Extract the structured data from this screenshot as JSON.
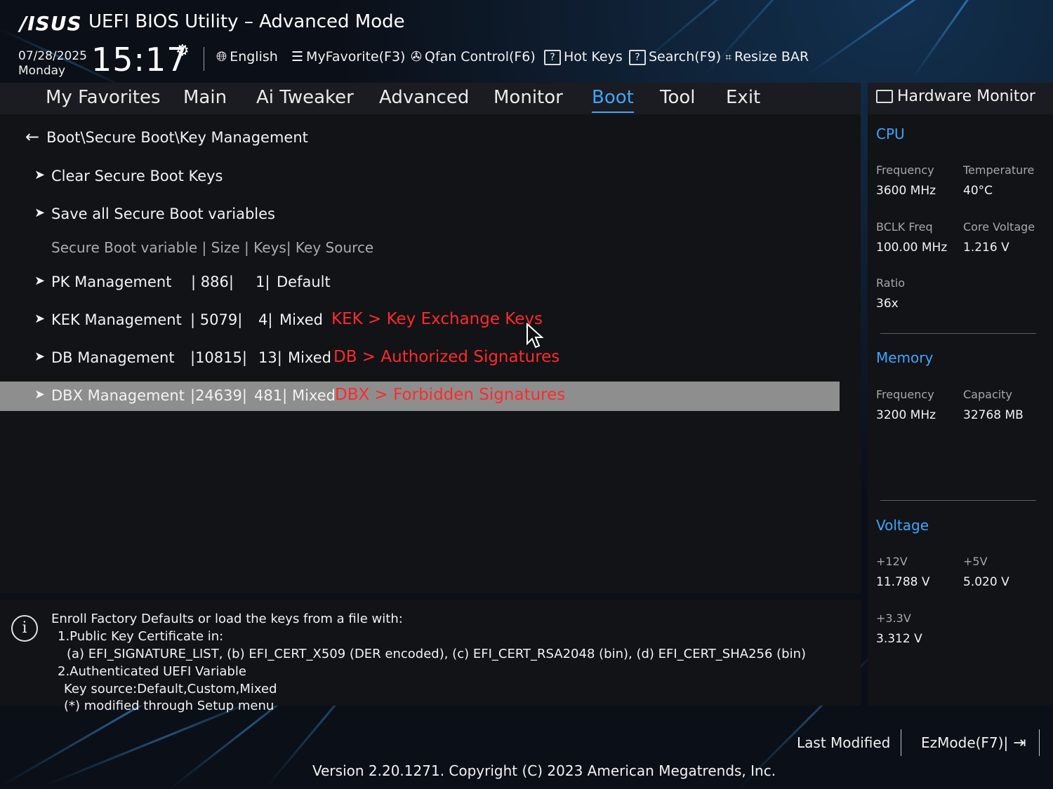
{
  "header": {
    "logo": "/ISUS",
    "title": "UEFI BIOS Utility – Advanced Mode",
    "date": "07/28/2025",
    "day": "Monday",
    "time": "15:17",
    "tools": {
      "language": "English",
      "myfavorite": "MyFavorite(F3)",
      "qfan": "Qfan Control(F6)",
      "hotkeys": "Hot Keys",
      "search": "Search(F9)",
      "resizebar": "Resize BAR"
    }
  },
  "tabs": [
    {
      "label": "My Favorites"
    },
    {
      "label": "Main"
    },
    {
      "label": "Ai Tweaker"
    },
    {
      "label": "Advanced"
    },
    {
      "label": "Monitor"
    },
    {
      "label": "Boot"
    },
    {
      "label": "Tool"
    },
    {
      "label": "Exit"
    }
  ],
  "active_tab": "Boot",
  "main": {
    "breadcrumb": "Boot\\Secure Boot\\Key Management",
    "actions": [
      {
        "label": "Clear Secure Boot Keys"
      },
      {
        "label": "Save all Secure Boot variables"
      }
    ],
    "table_header": "Secure Boot variable  |  Size |  Keys|  Key Source",
    "rows": [
      {
        "label": "PK Management",
        "size": "|   886|",
        "keys": "1|",
        "source": "Default",
        "annotation": ""
      },
      {
        "label": "KEK Management",
        "size": "| 5079|",
        "keys": "4|",
        "source": "Mixed",
        "annotation": "KEK > Key Exchange Keys"
      },
      {
        "label": "DB Management",
        "size": "|10815|",
        "keys": "13|",
        "source": "Mixed",
        "annotation": "DB > Authorized Signatures"
      },
      {
        "label": "DBX Management",
        "size": "|24639|",
        "keys": "481|",
        "source": "Mixed",
        "annotation": "DBX > Forbidden Signatures"
      }
    ]
  },
  "info": {
    "lines": [
      "Enroll Factory Defaults or load the keys from a file with:",
      "1.Public Key Certificate in:",
      "(a) EFI_SIGNATURE_LIST,  (b) EFI_CERT_X509 (DER encoded),  (c) EFI_CERT_RSA2048 (bin),  (d) EFI_CERT_SHA256 (bin)",
      "2.Authenticated UEFI Variable",
      "Key source:Default,Custom,Mixed",
      "(*) modified through Setup menu"
    ]
  },
  "hardware_monitor": {
    "title": "Hardware Monitor",
    "cpu": {
      "label": "CPU",
      "frequency_label": "Frequency",
      "frequency": "3600 MHz",
      "temperature_label": "Temperature",
      "temperature": "40°C",
      "bclk_label": "BCLK Freq",
      "bclk": "100.00 MHz",
      "core_voltage_label": "Core Voltage",
      "core_voltage": "1.216 V",
      "ratio_label": "Ratio",
      "ratio": "36x"
    },
    "memory": {
      "label": "Memory",
      "frequency_label": "Frequency",
      "frequency": "3200 MHz",
      "capacity_label": "Capacity",
      "capacity": "32768 MB"
    },
    "voltage": {
      "label": "Voltage",
      "v12_label": "+12V",
      "v12": "11.788 V",
      "v5_label": "+5V",
      "v5": "5.020 V",
      "v33_label": "+3.3V",
      "v33": "3.312 V"
    }
  },
  "footer": {
    "last_modified": "Last Modified",
    "ezmode": "EzMode(F7)|",
    "version": "Version 2.20.1271. Copyright (C) 2023 American Megatrends, Inc."
  }
}
